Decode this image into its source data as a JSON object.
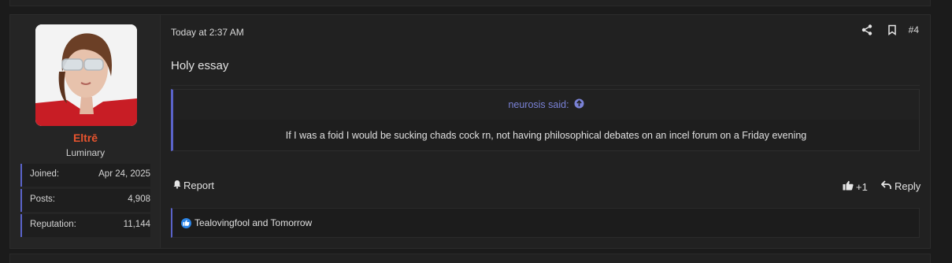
{
  "post": {
    "date": "Today at 2:37 AM",
    "number": "#4",
    "body": "Holy essay"
  },
  "user": {
    "name": "Eltrē",
    "title": "Luminary",
    "stats": {
      "joined_label": "Joined:",
      "joined_value": "Apr 24, 2025",
      "posts_label": "Posts:",
      "posts_value": "4,908",
      "rep_label": "Reputation:",
      "rep_value": "11,144"
    }
  },
  "quote": {
    "attribution": "neurosis said:",
    "text": "If I was a foid I would be sucking chads cock rn, not having philosophical debates on an incel forum on a Friday evening"
  },
  "actions": {
    "report": "Report",
    "reaction_count": "+1",
    "reply": "Reply"
  },
  "reactions": {
    "text": "Tealovingfool and Tomorrow"
  },
  "colors": {
    "username": "#e8542e",
    "accent": "#5a63c9",
    "quote_link": "#7a82d6",
    "like": "#2b84e6"
  }
}
